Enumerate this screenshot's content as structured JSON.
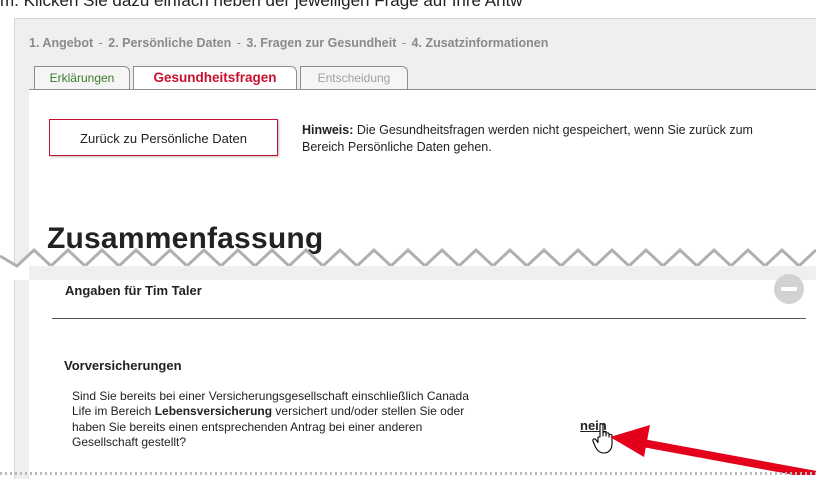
{
  "instruction_text": "m. Klicken Sie dazu einfach neben der jeweiligen Frage auf Ihre Antw",
  "steps": [
    "1. Angebot",
    "2. Persönliche Daten",
    "3. Fragen zur Gesundheit",
    "4. Zusatzinformationen"
  ],
  "step_separator": "-",
  "tabs": [
    {
      "label": "Erklärungen",
      "state": "inactive"
    },
    {
      "label": "Gesundheitsfragen",
      "state": "active"
    },
    {
      "label": "Entscheidung",
      "state": "disabled"
    }
  ],
  "back_button": "Zurück zu Persönliche Daten",
  "hint": {
    "label": "Hinweis:",
    "text": "Die Gesundheitsfragen werden nicht gespeichert, wenn Sie zurück zum Bereich Persönliche Daten gehen."
  },
  "summary_heading": "Zusammenfassung",
  "person_label": "Angaben für Tim Taler",
  "section_title": "Vorversicherungen",
  "question": {
    "part1": "Sind Sie bereits bei einer Versicherungsgesellschaft einschließlich Canada Life im Bereich ",
    "bold": "Lebensversicherung",
    "part2": " versichert und/oder stellen Sie oder haben Sie bereits einen entsprechenden Antrag bei einer anderen Gesellschaft gestellt?"
  },
  "answer": "nein",
  "colors": {
    "accent_red": "#c8102e",
    "tab_green": "#3a7a2a",
    "panel_gray": "#efefef",
    "arrow_red": "#e4001b"
  },
  "icons": [
    "collapse-minus-icon",
    "hand-pointer-icon",
    "red-arrow-icon"
  ]
}
